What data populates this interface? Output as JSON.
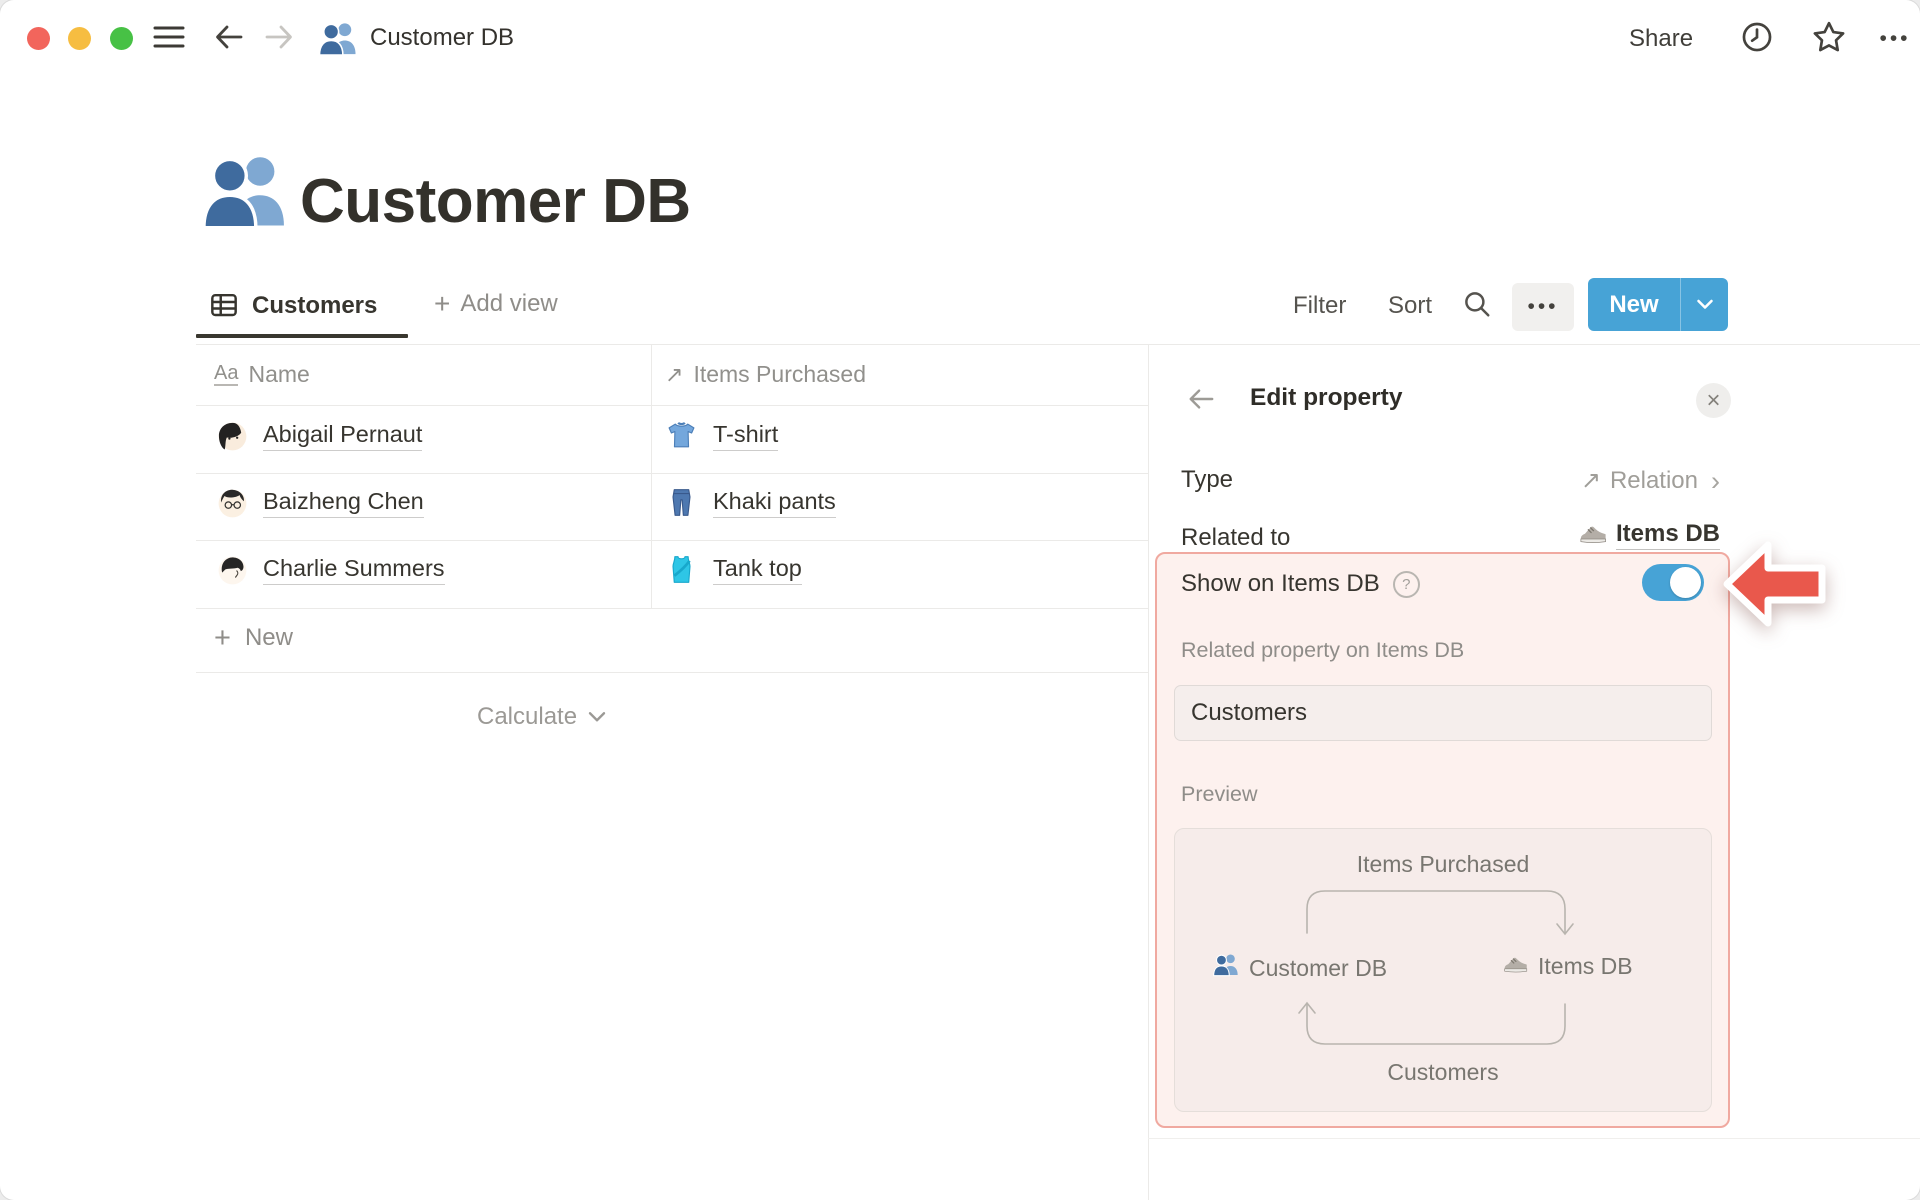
{
  "window": {
    "breadcrumb_title": "Customer DB"
  },
  "topbar": {
    "share_label": "Share",
    "more_glyph": "•••"
  },
  "page": {
    "title": "Customer DB"
  },
  "views": {
    "active_tab": "Customers",
    "add_view_label": "Add view",
    "plus_glyph": "+"
  },
  "toolbar": {
    "filter_label": "Filter",
    "sort_label": "Sort",
    "more_glyph": "•••",
    "new_label": "New"
  },
  "table": {
    "header": {
      "name": {
        "icon_glyph": "Aa",
        "label": "Name"
      },
      "items": {
        "icon_glyph": "↗",
        "label": "Items Purchased"
      }
    },
    "rows": [
      {
        "name": "Abigail Pernaut",
        "item": "T-shirt"
      },
      {
        "name": "Baizheng Chen",
        "item": "Khaki pants"
      },
      {
        "name": "Charlie Summers",
        "item": "Tank top"
      }
    ],
    "new_row_label": "New",
    "new_row_plus": "+",
    "calculate_label": "Calculate"
  },
  "panel": {
    "title": "Edit property",
    "close_glyph": "×",
    "type_row": {
      "label": "Type",
      "icon_glyph": "↗",
      "value": "Relation",
      "chevron_glyph": "›"
    },
    "related_row": {
      "label": "Related to",
      "value": "Items DB"
    },
    "highlight": {
      "show_label": "Show on Items DB",
      "help_glyph": "?",
      "toggle_state": "on",
      "related_property_label": "Related property on Items DB",
      "related_property_value": "Customers",
      "preview_label": "Preview",
      "preview": {
        "top_label": "Items Purchased",
        "left_node": "Customer DB",
        "right_node": "Items DB",
        "bottom_label": "Customers"
      }
    }
  },
  "colors": {
    "accent_blue": "#47a3d6",
    "highlight_bg": "#fdf1ee",
    "highlight_border": "#f0a9a0",
    "arrow_red": "#e9584c",
    "text_dark": "#37352f",
    "text_gray": "#9b9a97"
  }
}
